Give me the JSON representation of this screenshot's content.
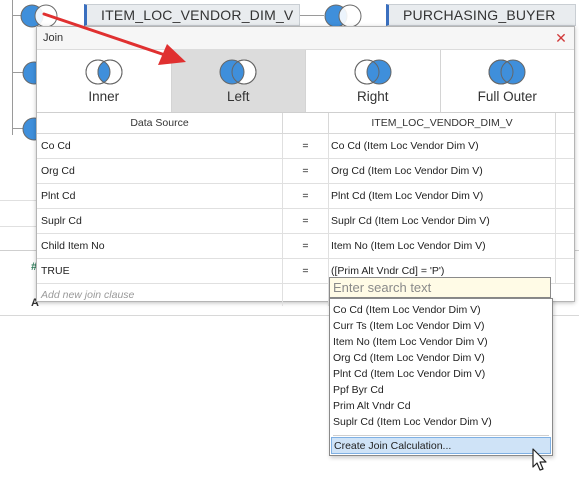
{
  "background": {
    "node_left_label": "ITEM_LOC_VENDOR_DIM_V",
    "node_right_label": "PURCHASING_BUYER",
    "strip_char_1": "#",
    "strip_char_2": "A"
  },
  "dialog": {
    "title": "Join",
    "close_icon": "close-icon",
    "join_types": [
      {
        "label": "Inner",
        "selected": false
      },
      {
        "label": "Left",
        "selected": true
      },
      {
        "label": "Right",
        "selected": false
      },
      {
        "label": "Full Outer",
        "selected": false
      }
    ],
    "colors": {
      "venn_blue": "#3f8fdb",
      "selected_bg": "#dcdcdc",
      "close_red": "#d13a3a",
      "arrow_red": "#e03030"
    },
    "columns": {
      "left": "Data Source",
      "right": "ITEM_LOC_VENDOR_DIM_V"
    },
    "clauses": [
      {
        "left": "Co Cd",
        "op": "=",
        "right": "Co Cd (Item Loc Vendor Dim V)"
      },
      {
        "left": "Org Cd",
        "op": "=",
        "right": "Org Cd (Item Loc Vendor Dim V)"
      },
      {
        "left": "Plnt Cd",
        "op": "=",
        "right": "Plnt Cd (Item Loc Vendor Dim V)"
      },
      {
        "left": "Suplr Cd",
        "op": "=",
        "right": "Suplr Cd (Item Loc Vendor Dim V)"
      },
      {
        "left": "Child Item No",
        "op": "=",
        "right": "Item No (Item Loc Vendor Dim V)"
      },
      {
        "left": "TRUE",
        "op": "=",
        "right": "([Prim Alt Vndr Cd] = 'P')"
      }
    ],
    "add_clause_placeholder": "Add new join clause"
  },
  "dropdown": {
    "search_placeholder": "Enter search text",
    "items": [
      "Co Cd (Item Loc Vendor Dim V)",
      "Curr Ts (Item Loc Vendor Dim V)",
      "Item No (Item Loc Vendor Dim V)",
      "Org Cd (Item Loc Vendor Dim V)",
      "Plnt Cd (Item Loc Vendor Dim V)",
      "Ppf Byr Cd",
      "Prim Alt Vndr Cd",
      "Suplr Cd (Item Loc Vendor Dim V)"
    ],
    "create_calc": "Create Join Calculation..."
  }
}
